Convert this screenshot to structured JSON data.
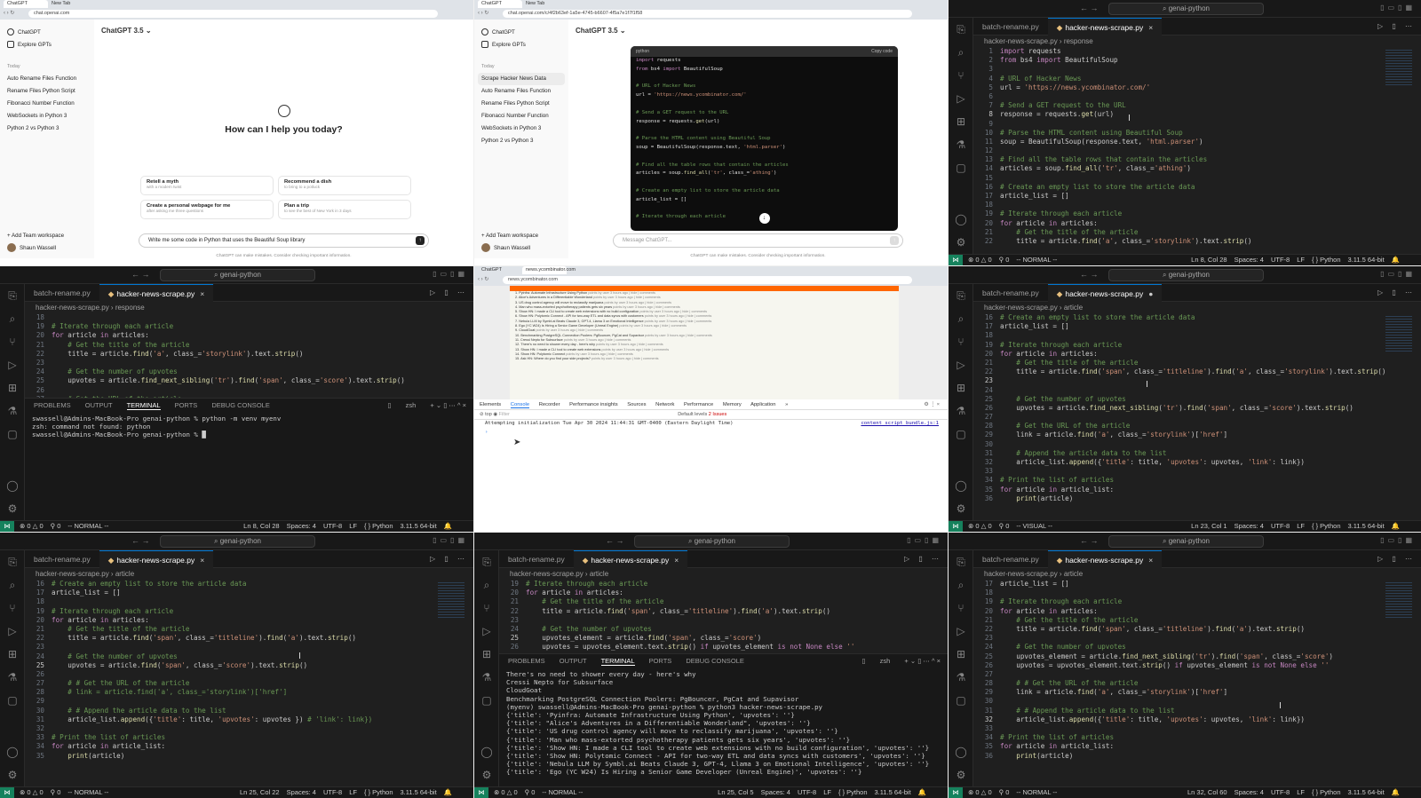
{
  "app": {
    "folder": "genai-python",
    "tab_other": "batch-rename.py",
    "tab_active": "hacker-news-scrape.py",
    "breadcrumb_file": "hacker-news-scrape.py",
    "python_label": "Python",
    "python_version": "3.11.5 64-bit",
    "encoding": "UTF-8",
    "eol": "LF",
    "spaces": "Spaces: 4",
    "errors": "0",
    "warnings": "0",
    "ports": "0",
    "colors": {
      "accent": "#0078d4",
      "remote": "#16825d",
      "editor_bg": "#1f1f1f",
      "hn_orange": "#ff6600"
    }
  },
  "chatgpt": {
    "window1_url": "chat.openai.com",
    "window2_url": "chat.openai.com/c/4f2b63ef-1a5e-4745-b6607-4f5a7e1f7f1f58",
    "new_tab_label": "New Tab",
    "brand": "ChatGPT",
    "explore": "Explore GPTs",
    "today": "Today",
    "history": [
      "Auto Rename Files Function",
      "Rename Files Python Script",
      "Fibonacci Number Function",
      "WebSockets in Python 3",
      "Python 2 vs Python 3"
    ],
    "history_new": "Scrape Hacker News Data",
    "model": "ChatGPT 3.5",
    "greeting": "How can I help you today?",
    "suggestions": [
      {
        "title": "Retell a myth",
        "sub": "with a modern twist"
      },
      {
        "title": "Recommend a dish",
        "sub": "to bring to a potluck"
      },
      {
        "title": "Create a personal webpage for me",
        "sub": "after asking me three questions"
      },
      {
        "title": "Plan a trip",
        "sub": "to see the best of New York in 3 days"
      }
    ],
    "team": "Add Team workspace",
    "team_sub": "Collaborate on a Team plan",
    "user": "Shaun Wassell",
    "prompt": "Write me some code in Python that uses the Beautiful Soup library",
    "message_placeholder": "Message ChatGPT...",
    "disclaimer": "ChatGPT can make mistakes. Consider checking important information.",
    "code_lang": "python",
    "copy_code": "Copy code",
    "code_lines": [
      "import requests",
      "from bs4 import BeautifulSoup",
      "",
      "# URL of Hacker News",
      "url = 'https://news.ycombinator.com/'",
      "",
      "# Send a GET request to the URL",
      "response = requests.get(url)",
      "",
      "# Parse the HTML content using Beautiful Soup",
      "soup = BeautifulSoup(response.text, 'html.parser')",
      "",
      "# Find all the table rows that contain the articles",
      "articles = soup.find_all('tr', class_='athing')",
      "",
      "# Create an empty list to store the article data",
      "article_list = []",
      "",
      "# Iterate through each article"
    ]
  },
  "vs1": {
    "symbol": "response",
    "mode": "-- NORMAL --",
    "position": "Ln 8, Col 28",
    "lines": [
      [
        "1",
        "import requests"
      ],
      [
        "2",
        "from bs4 import BeautifulSoup"
      ],
      [
        "3",
        ""
      ],
      [
        "4",
        "# URL of Hacker News"
      ],
      [
        "5",
        "url = 'https://news.ycombinator.com/'"
      ],
      [
        "6",
        ""
      ],
      [
        "7",
        "# Send a GET request to the URL"
      ],
      [
        "8",
        "response = requests.get(url)"
      ],
      [
        "9",
        ""
      ],
      [
        "10",
        "# Parse the HTML content using Beautiful Soup"
      ],
      [
        "11",
        "soup = BeautifulSoup(response.text, 'html.parser')"
      ],
      [
        "12",
        ""
      ],
      [
        "13",
        "# Find all the table rows that contain the articles"
      ],
      [
        "14",
        "articles = soup.find_all('tr', class_='athing')"
      ],
      [
        "15",
        ""
      ],
      [
        "16",
        "# Create an empty list to store the article data"
      ],
      [
        "17",
        "article_list = []"
      ],
      [
        "18",
        ""
      ],
      [
        "19",
        "# Iterate through each article"
      ],
      [
        "20",
        "for article in articles:"
      ],
      [
        "21",
        "    # Get the title of the article"
      ],
      [
        "22",
        "    title = article.find('a', class_='storylink').text.strip()"
      ]
    ]
  },
  "vs2": {
    "symbol": "response",
    "mode": "-- NORMAL --",
    "position": "Ln 8, Col 28",
    "lines": [
      [
        "18",
        ""
      ],
      [
        "19",
        "# Iterate through each article"
      ],
      [
        "20",
        "for article in articles:"
      ],
      [
        "21",
        "    # Get the title of the article"
      ],
      [
        "22",
        "    title = article.find('a', class_='storylink').text.strip()"
      ],
      [
        "23",
        ""
      ],
      [
        "24",
        "    # Get the number of upvotes"
      ],
      [
        "25",
        "    upvotes = article.find_next_sibling('tr').find('span', class_='score').text.strip()"
      ],
      [
        "26",
        ""
      ],
      [
        "27",
        "    # Get the URL of the article"
      ]
    ],
    "panel_tabs": [
      "PROBLEMS",
      "OUTPUT",
      "TERMINAL",
      "PORTS",
      "DEBUG CONSOLE"
    ],
    "shell": "zsh",
    "terminal": [
      "swassell@Admins-MacBook-Pro genai-python % python -m venv myenv",
      "zsh: command not found: python",
      "swassell@Admins-MacBook-Pro genai-python % █"
    ]
  },
  "devtools": {
    "url": "news.ycombinator.com",
    "hn_items": [
      "1. Pyinfra: Automate Infrastructure Using Python",
      "2. Alice's Adventures in a Differentiable Wonderland",
      "3. US drug control agency will move to reclassify marijuana",
      "4. Man who mass-extorted psychotherapy patients gets six years",
      "5. Show HN: I made a CLI tool to create web extensions with no build configuration",
      "6. Show HN: Polytomic Connect - API for two-way ETL and data syncs with customers",
      "7. Nebula LLM by Symbl.ai Beats Claude 3, GPT-4, Llama 3 on Emotional Intelligence",
      "8. Ego (YC W24) Is Hiring a Senior Game Developer (Unreal Engine)",
      "9. CloudGoat",
      "10. Benchmarking PostgreSQL Connection Poolers: PgBouncer, PgCat and Supavisor",
      "11. Cressi Nepto for Subsurface",
      "12. There's no need to shower every day - here's why",
      "13. Show HN: I made a CLI tool to create web extensions",
      "14. Show HN: Polytomic Connect",
      "15. Ask HN: Where do you find your side projects?"
    ],
    "hn_meta": "points by user 3 hours ago | hide | comments",
    "tabs": [
      "Elements",
      "Console",
      "Recorder",
      "Performance insights",
      "Sources",
      "Network",
      "Performance",
      "Memory",
      "Application",
      "»"
    ],
    "top": "top",
    "filter": "Filter",
    "levels": "Default levels",
    "issues": "2 Issues",
    "log": "Attempting initialization Tue Apr 30 2024 11:44:31 GMT-0400 (Eastern Daylight Time)",
    "log_src": "content_script_bundle.js:1"
  },
  "vs3": {
    "symbol": "article",
    "mode": "-- VISUAL --",
    "position": "Ln 23, Col 1",
    "lines": [
      [
        "16",
        "# Create an empty list to store the article data"
      ],
      [
        "17",
        "article_list = []"
      ],
      [
        "18",
        ""
      ],
      [
        "19",
        "# Iterate through each article"
      ],
      [
        "20",
        "for article in articles:"
      ],
      [
        "21",
        "    # Get the title of the article"
      ],
      [
        "22",
        "    title = article.find('span', class_='titleline').find('a', class_='storylink').text.strip()"
      ],
      [
        "23",
        ""
      ],
      [
        "24",
        ""
      ],
      [
        "25",
        "    # Get the number of upvotes"
      ],
      [
        "26",
        "    upvotes = article.find_next_sibling('tr').find('span', class_='score').text.strip()"
      ],
      [
        "27",
        ""
      ],
      [
        "28",
        "    # Get the URL of the article"
      ],
      [
        "29",
        "    link = article.find('a', class_='storylink')['href']"
      ],
      [
        "30",
        ""
      ],
      [
        "31",
        "    # Append the article data to the list"
      ],
      [
        "32",
        "    article_list.append({'title': title, 'upvotes': upvotes, 'link': link})"
      ],
      [
        "33",
        ""
      ],
      [
        "34",
        "# Print the list of articles"
      ],
      [
        "35",
        "for article in article_list:"
      ],
      [
        "36",
        "    print(article)"
      ]
    ]
  },
  "vs4": {
    "symbol": "article",
    "mode": "-- NORMAL --",
    "position": "Ln 25, Col 22",
    "lines": [
      [
        "16",
        "# Create an empty list to store the article data"
      ],
      [
        "17",
        "article_list = []"
      ],
      [
        "18",
        ""
      ],
      [
        "19",
        "# Iterate through each article"
      ],
      [
        "20",
        "for article in articles:"
      ],
      [
        "21",
        "    # Get the title of the article"
      ],
      [
        "22",
        "    title = article.find('span', class_='titleline').find('a').text.strip()"
      ],
      [
        "23",
        ""
      ],
      [
        "24",
        "    # Get the number of upvotes"
      ],
      [
        "25",
        "    upvotes = article.find('span', class_='score').text.strip()"
      ],
      [
        "26",
        ""
      ],
      [
        "27",
        "    # # Get the URL of the article"
      ],
      [
        "28",
        "    # link = article.find('a', class_='storylink')['href']"
      ],
      [
        "29",
        ""
      ],
      [
        "30",
        "    # # Append the article data to the list"
      ],
      [
        "31",
        "    article_list.append({'title': title, 'upvotes': upvotes }) # 'link': link})"
      ],
      [
        "32",
        ""
      ],
      [
        "33",
        "# Print the list of articles"
      ],
      [
        "34",
        "for article in article_list:"
      ],
      [
        "35",
        "    print(article)"
      ]
    ]
  },
  "vs5": {
    "symbol": "article",
    "mode": "-- NORMAL --",
    "position": "Ln 25, Col 5",
    "lines": [
      [
        "19",
        "# Iterate through each article"
      ],
      [
        "20",
        "for article in articles:"
      ],
      [
        "21",
        "    # Get the title of the article"
      ],
      [
        "22",
        "    title = article.find('span', class_='titleline').find('a').text.strip()"
      ],
      [
        "23",
        ""
      ],
      [
        "24",
        "    # Get the number of upvotes"
      ],
      [
        "25",
        "    upvotes_element = article.find('span', class_='score')"
      ],
      [
        "26",
        "    upvotes = upvotes_element.text.strip() if upvotes_element is not None else ''"
      ]
    ],
    "terminal": [
      "There's no need to shower every day - here's why",
      "Cressi Nepto for Subsurface",
      "CloudGoat",
      "Benchmarking PostgreSQL Connection Poolers: PgBouncer, PgCat and Supavisor",
      "(myenv) swassell@Admins-MacBook-Pro genai-python % python3 hacker-news-scrape.py",
      "{'title': 'Pyinfra: Automate Infrastructure Using Python', 'upvotes': ''}",
      "{'title': \"Alice's Adventures in a Differentiable Wonderland\", 'upvotes': ''}",
      "{'title': 'US drug control agency will move to reclassify marijuana', 'upvotes': ''}",
      "{'title': 'Man who mass-extorted psychotherapy patients gets six years', 'upvotes': ''}",
      "{'title': 'Show HN: I made a CLI tool to create web extensions with no build configuration', 'upvotes': ''}",
      "{'title': 'Show HN: Polytomic Connect - API for two-way ETL and data syncs with customers', 'upvotes': ''}",
      "{'title': 'Nebula LLM by Symbl.ai Beats Claude 3, GPT-4, Llama 3 on Emotional Intelligence', 'upvotes': ''}",
      "{'title': 'Ego (YC W24) Is Hiring a Senior Game Developer (Unreal Engine)', 'upvotes': ''}"
    ]
  },
  "vs6": {
    "symbol": "article",
    "mode": "-- NORMAL --",
    "position": "Ln 32, Col 60",
    "lines": [
      [
        "17",
        "article_list = []"
      ],
      [
        "18",
        ""
      ],
      [
        "19",
        "# Iterate through each article"
      ],
      [
        "20",
        "for article in articles:"
      ],
      [
        "21",
        "    # Get the title of the article"
      ],
      [
        "22",
        "    title = article.find('span', class_='titleline').find('a').text.strip()"
      ],
      [
        "23",
        ""
      ],
      [
        "24",
        "    # Get the number of upvotes"
      ],
      [
        "25",
        "    upvotes_element = article.find_next_sibling('tr').find('span', class_='score')"
      ],
      [
        "26",
        "    upvotes = upvotes_element.text.strip() if upvotes_element is not None else ''"
      ],
      [
        "27",
        ""
      ],
      [
        "28",
        "    # # Get the URL of the article"
      ],
      [
        "29",
        "    link = article.find('a', class_='storylink')['href']"
      ],
      [
        "30",
        ""
      ],
      [
        "31",
        "    # # Append the article data to the list"
      ],
      [
        "32",
        "    article_list.append({'title': title, 'upvotes': upvotes, 'link': link})"
      ],
      [
        "33",
        ""
      ],
      [
        "34",
        "# Print the list of articles"
      ],
      [
        "35",
        "for article in article_list:"
      ],
      [
        "36",
        "    print(article)"
      ]
    ]
  }
}
